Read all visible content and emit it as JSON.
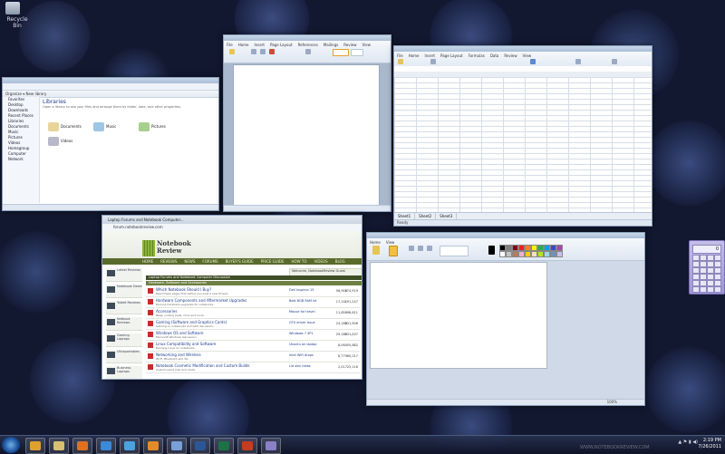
{
  "desktop": {
    "recycle_bin_label": "Recycle Bin"
  },
  "explorer": {
    "title": "Libraries",
    "toolbar": "Organize ▾   New library",
    "nav_items": [
      "Favorites",
      "Desktop",
      "Downloads",
      "Recent Places",
      "",
      "Libraries",
      "Documents",
      "Music",
      "Pictures",
      "Videos",
      "",
      "Homegroup",
      "Computer",
      "Network"
    ],
    "library_heading": "Libraries",
    "library_subtitle": "Open a library to see your files and arrange them by folder, date, and other properties.",
    "items": [
      "Documents",
      "Music",
      "Pictures",
      "Videos"
    ]
  },
  "word": {
    "tabs": [
      "File",
      "Home",
      "Insert",
      "Page Layout",
      "References",
      "Mailings",
      "Review",
      "View"
    ]
  },
  "excel": {
    "tabs": [
      "File",
      "Home",
      "Insert",
      "Page Layout",
      "Formulas",
      "Data",
      "Review",
      "View"
    ],
    "sheets": [
      "Sheet1",
      "Sheet2",
      "Sheet3"
    ],
    "status": "Ready"
  },
  "browser": {
    "tab_title": "Laptop Forums and Notebook Computer...",
    "url": "forum.notebookreview.com",
    "logo_line1": "Notebook",
    "logo_line2": "Review",
    "nav": [
      "HOME",
      "REVIEWS",
      "NEWS",
      "FORUMS",
      "BUYER'S GUIDE",
      "PRICE GUIDE",
      "HOW TO",
      "VIDEOS",
      "BLOG"
    ],
    "welcome": "Welcome, NotebookReview Guest",
    "forum_header": "Laptop Forums and Notebook Computer Discussion",
    "section": "Hardware, Software and Accessories",
    "side_items": [
      "Latest Reviews",
      "Notebook Deals",
      "Tablet Reviews",
      "Netbook Reviews",
      "Gaming Laptops",
      "Ultraportables",
      "Business Laptops",
      "Lenovo",
      "Dell"
    ],
    "rows": [
      {
        "title": "Which Notebook Should I Buy?",
        "desc": "Read these pages first before you post a new thread.",
        "last": "Dell Inspiron 15",
        "n1": "56,918",
        "n2": "574,919"
      },
      {
        "title": "Hardware Components and Aftermarket Upgrades",
        "desc": "Discuss hardware upgrades for notebooks.",
        "last": "Best 8GB RAM kit",
        "n1": "17,141",
        "n2": "191,247"
      },
      {
        "title": "Accessories",
        "desc": "Bags, cooling pads, mice and more.",
        "last": "Mouse for travel",
        "n1": "11,858",
        "n2": "98,611"
      },
      {
        "title": "Gaming (Software and Graphics Cards)",
        "desc": "Gaming on notebooks and GPU discussion.",
        "last": "GTX driver issue",
        "n1": "24,188",
        "n2": "331,906"
      },
      {
        "title": "Windows OS and Software",
        "desc": "Microsoft Windows discussion.",
        "last": "Windows 7 SP1",
        "n1": "29,189",
        "n2": "231,007"
      },
      {
        "title": "Linux Compatibility and Software",
        "desc": "Running Linux on notebooks.",
        "last": "Ubuntu on laptop",
        "n1": "8,060",
        "n2": "55,882"
      },
      {
        "title": "Networking and Wireless",
        "desc": "Wi-Fi, Bluetooth and 3G.",
        "last": "Intel WiFi drops",
        "n1": "8,779",
        "n2": "60,017"
      },
      {
        "title": "Notebook Cosmetic Modification and Custom Builds",
        "desc": "Custom paint jobs and mods.",
        "last": "Lid skin ideas",
        "n1": "2,017",
        "n2": "25,116"
      }
    ]
  },
  "paint": {
    "tabs": [
      "Home",
      "View"
    ],
    "status": "100%",
    "colors": [
      "#000000",
      "#7f7f7f",
      "#880015",
      "#ed1c24",
      "#ff7f27",
      "#fff200",
      "#22b14c",
      "#00a2e8",
      "#3f48cc",
      "#a349a4",
      "#ffffff",
      "#c3c3c3",
      "#b97a57",
      "#ffaec9",
      "#ffc90e",
      "#efe4b0",
      "#b5e61d",
      "#99d9ea",
      "#7092be",
      "#c8bfe7"
    ]
  },
  "calculator": {
    "display": "0"
  },
  "taskbar": {
    "apps": [
      {
        "name": "chrome",
        "color": "#e0a030"
      },
      {
        "name": "explorer",
        "color": "#d8c070"
      },
      {
        "name": "media-player",
        "color": "#e07020"
      },
      {
        "name": "ie",
        "color": "#3a8ad8"
      },
      {
        "name": "windows-live",
        "color": "#4aa3df"
      },
      {
        "name": "firefox",
        "color": "#e58a2a"
      },
      {
        "name": "paint",
        "color": "#7aa0d8"
      },
      {
        "name": "word",
        "color": "#2b5797"
      },
      {
        "name": "excel",
        "color": "#1e7145"
      },
      {
        "name": "powerpoint",
        "color": "#c43e1c"
      },
      {
        "name": "calculator",
        "color": "#8a80c8"
      }
    ],
    "time": "2:19 PM",
    "date": "7/26/2011"
  },
  "watermark": "WWW.NOTEBOOKREVIEW.COM"
}
